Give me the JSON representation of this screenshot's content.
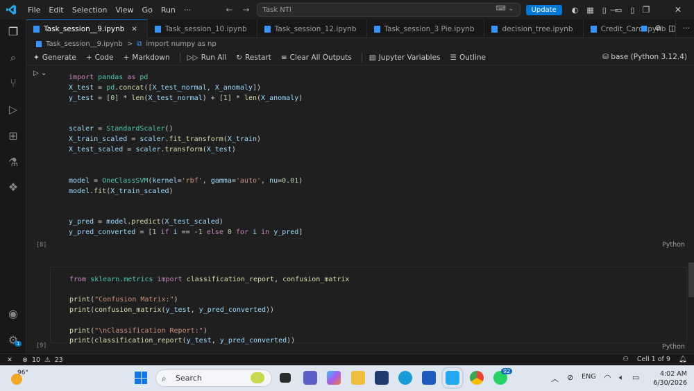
{
  "menu": [
    "File",
    "Edit",
    "Selection",
    "View",
    "Go",
    "Run",
    "···"
  ],
  "search": {
    "value": "Task NTI"
  },
  "update_label": "Update",
  "tabs": [
    {
      "label": "Task_session__9.ipynb",
      "active": true
    },
    {
      "label": "Task_session_10.ipynb"
    },
    {
      "label": "Task_session_12.ipynb"
    },
    {
      "label": "Task_session_3 Pie.ipynb"
    },
    {
      "label": "decision_tree.ipynb"
    },
    {
      "label": "Credit_Card.ipynb"
    }
  ],
  "breadcrumb": {
    "file": "Task_session__9.ipynb",
    "sep": ">",
    "cell": "import numpy as np"
  },
  "toolbar": {
    "generate": "Generate",
    "code": "Code",
    "markdown": "Markdown",
    "run_all": "Run All",
    "restart": "Restart",
    "clear_outputs": "Clear All Outputs",
    "variables": "Jupyter Variables",
    "outline": "Outline",
    "kernel": "base (Python 3.12.4)"
  },
  "cells": [
    {
      "exec_count": "[8]",
      "language": "Python",
      "lines": [
        "import pandas as pd",
        "X_test = pd.concat([X_test_normal, X_anomaly])",
        "y_test = [0] * len(X_test_normal) + [1] * len(X_anomaly)",
        "",
        "",
        "scaler = StandardScaler()",
        "X_train_scaled = scaler.fit_transform(X_train)",
        "X_test_scaled = scaler.transform(X_test)",
        "",
        "",
        "model = OneClassSVM(kernel='rbf', gamma='auto', nu=0.01)",
        "model.fit(X_train_scaled)",
        "",
        "",
        "y_pred = model.predict(X_test_scaled)",
        "y_pred_converted = [1 if i == -1 else 0 for i in y_pred]"
      ]
    },
    {
      "exec_count": "[9]",
      "language": "Python",
      "lines": [
        "from sklearn.metrics import classification_report, confusion_matrix",
        "",
        "print(\"Confusion Matrix:\")",
        "print(confusion_matrix(y_test, y_pred_converted))",
        "",
        "print(\"\\nClassification Report:\")",
        "print(classification_report(y_test, y_pred_converted))"
      ]
    }
  ],
  "status": {
    "errors": "10",
    "warnings": "23",
    "cell_position": "Cell 1 of 9"
  },
  "taskbar": {
    "temperature": "96°",
    "search_label": "Search",
    "whatsapp_badge": "92",
    "language": "ENG",
    "time": "4:02 AM",
    "date": "6/30/2026"
  },
  "accounts_badge": "1",
  "colors": {
    "accent": "#0078d4",
    "editor_bg": "#1f1f1f",
    "keyword": "#c586c0",
    "function": "#dcdcaa",
    "variable": "#9cdcfe",
    "string": "#ce9178",
    "number": "#b5cea8"
  }
}
